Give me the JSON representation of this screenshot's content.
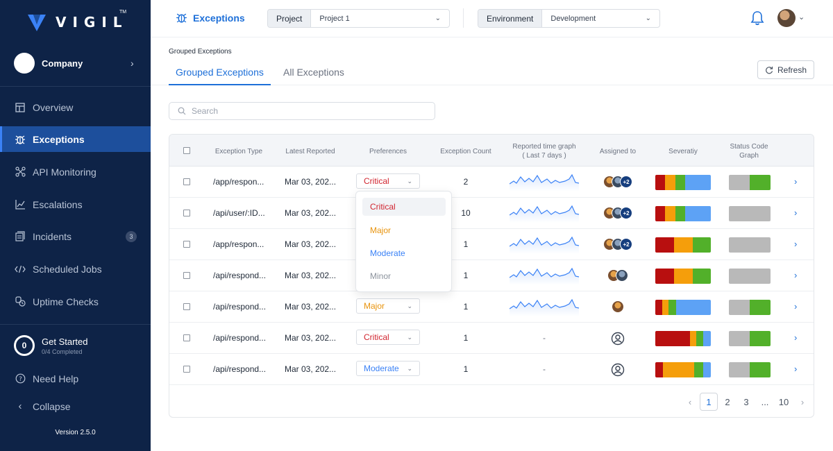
{
  "brand": {
    "name": "VIGIL",
    "tm": "TM"
  },
  "company": {
    "name": "Company"
  },
  "sidebar": {
    "items": [
      {
        "label": "Overview",
        "icon": "overview-icon"
      },
      {
        "label": "Exceptions",
        "icon": "bug-icon",
        "active": true
      },
      {
        "label": "API Monitoring",
        "icon": "api-network-icon"
      },
      {
        "label": "Escalations",
        "icon": "chart-escalation-icon"
      },
      {
        "label": "Incidents",
        "icon": "incidents-icon",
        "badge": "3"
      },
      {
        "label": "Scheduled Jobs",
        "icon": "code-icon"
      },
      {
        "label": "Uptime Checks",
        "icon": "uptime-icon"
      }
    ],
    "get_started": {
      "progress": "0",
      "title": "Get Started",
      "subtitle": "0/4 Completed"
    },
    "need_help": "Need Help",
    "collapse": "Collapse",
    "version": "Version 2.5.0"
  },
  "header": {
    "title": "Exceptions",
    "project": {
      "label": "Project",
      "value": "Project 1"
    },
    "environment": {
      "label": "Environment",
      "value": "Development"
    }
  },
  "breadcrumb": "Grouped Exceptions",
  "tabs": [
    {
      "label": "Grouped Exceptions",
      "active": true
    },
    {
      "label": "All Exceptions",
      "active": false
    }
  ],
  "refresh_label": "Refresh",
  "search": {
    "placeholder": "Search"
  },
  "table": {
    "headers": {
      "type": "Exception Type",
      "latest": "Latest Reported",
      "preferences": "Preferences",
      "count": "Exception Count",
      "graph_line1": "Reported time graph",
      "graph_line2": "( Last 7 days )",
      "assigned": "Assigned to",
      "severity": "Severatiy",
      "status_line1": "Status Code",
      "status_line2": "Graph"
    },
    "rows": [
      {
        "type": "/app/respon...",
        "latest": "Mar 03, 202...",
        "preference": "Critical",
        "count": "2",
        "graph": true,
        "assigned": "3+2",
        "more": "+2",
        "sev": [
          18,
          18,
          18,
          46
        ],
        "status": [
          50,
          50
        ]
      },
      {
        "type": "/api/user/:ID...",
        "latest": "Mar 03, 202...",
        "preference": "",
        "count": "10",
        "graph": true,
        "assigned": "3+2",
        "more": "+2",
        "sev": [
          18,
          18,
          18,
          46
        ],
        "status": [
          100,
          0
        ]
      },
      {
        "type": "/app/respon...",
        "latest": "Mar 03, 202...",
        "preference": "",
        "count": "1",
        "graph": true,
        "assigned": "3+2",
        "more": "+2",
        "sev": [
          34,
          33,
          33,
          0
        ],
        "status": [
          100,
          0
        ]
      },
      {
        "type": "/api/respond...",
        "latest": "Mar 03, 202...",
        "preference": "",
        "count": "1",
        "graph": true,
        "assigned": "2",
        "more": "",
        "sev": [
          34,
          33,
          33,
          0
        ],
        "status": [
          100,
          0
        ]
      },
      {
        "type": "/api/respond...",
        "latest": "Mar 03, 202...",
        "preference": "Major",
        "count": "1",
        "graph": true,
        "assigned": "1",
        "more": "",
        "sev": [
          12,
          12,
          14,
          62
        ],
        "status": [
          50,
          50
        ]
      },
      {
        "type": "/api/respond...",
        "latest": "Mar 03, 202...",
        "preference": "Critical",
        "count": "1",
        "graph": false,
        "graph_text": "-",
        "assigned": "0",
        "more": "",
        "sev": [
          62,
          12,
          12,
          14
        ],
        "status": [
          50,
          50
        ]
      },
      {
        "type": "/api/respond...",
        "latest": "Mar 03, 202...",
        "preference": "Moderate",
        "count": "1",
        "graph": false,
        "graph_text": "-",
        "assigned": "0",
        "more": "",
        "sev": [
          14,
          56,
          16,
          14
        ],
        "status": [
          50,
          50
        ]
      }
    ]
  },
  "dropdown": {
    "options": [
      {
        "label": "Critical",
        "color": "#d1242f",
        "selected": true
      },
      {
        "label": "Major",
        "color": "#e8930c",
        "selected": false
      },
      {
        "label": "Moderate",
        "color": "#3b82f6",
        "selected": false
      },
      {
        "label": "Minor",
        "color": "#8b929c",
        "selected": false
      }
    ]
  },
  "pagination": {
    "pages": [
      "1",
      "2",
      "3",
      "...",
      "10"
    ],
    "current": "1"
  },
  "colors": {
    "accent": "#1d6fd8",
    "critical": "#d1242f",
    "major": "#e8930c",
    "moderate": "#3b82f6",
    "sev_critical": "#b80f0f",
    "sev_major": "#f59e0b",
    "sev_moderate": "#52b02a",
    "sev_minor": "#5da2f5",
    "status_gray": "#b9b9b9",
    "status_green": "#52b02a"
  }
}
